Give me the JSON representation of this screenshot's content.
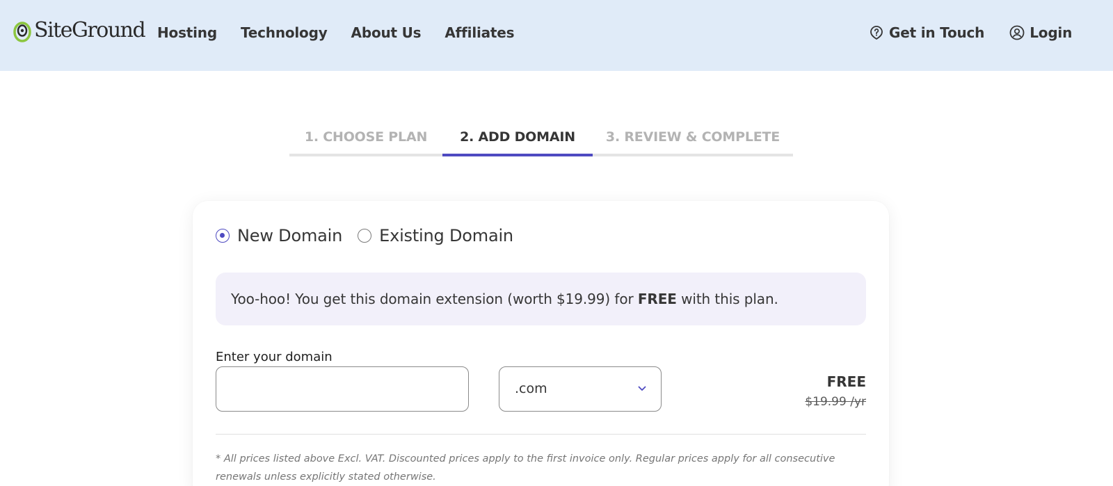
{
  "header": {
    "logo_text": "SiteGround",
    "nav": [
      "Hosting",
      "Technology",
      "About Us",
      "Affiliates"
    ],
    "get_in_touch": "Get in Touch",
    "login": "Login"
  },
  "steps": [
    {
      "label": "1. CHOOSE PLAN",
      "state": "inactive"
    },
    {
      "label": "2. ADD DOMAIN",
      "state": "active"
    },
    {
      "label": "3. REVIEW & COMPLETE",
      "state": "inactive"
    }
  ],
  "domain_form": {
    "options": [
      {
        "label": "New Domain",
        "checked": true
      },
      {
        "label": "Existing Domain",
        "checked": false
      }
    ],
    "promo": {
      "before": "Yoo-hoo! You get this domain extension (worth $19.99) for ",
      "bold": "FREE",
      "after": " with this plan."
    },
    "input_label": "Enter your domain",
    "input_value": "",
    "input_placeholder": "",
    "tld_selected": ".com",
    "price": "FREE",
    "old_price": "$19.99 /yr",
    "disclaimer": "* All prices listed above Excl. VAT. Discounted prices apply to the first invoice only. Regular prices apply for all consecutive renewals unless explicitly stated otherwise."
  },
  "colors": {
    "header_bg": "#e0ebf8",
    "accent": "#4e4ac1",
    "promo_bg": "#f2f0fa",
    "logo_green": "#8cc63f"
  }
}
